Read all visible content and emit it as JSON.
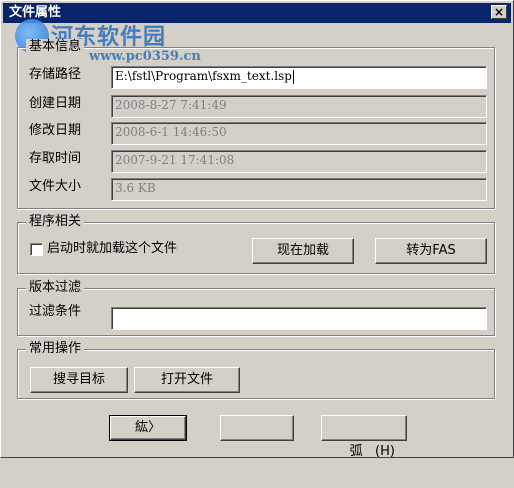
{
  "window": {
    "title": "文件属性",
    "close_label": "×"
  },
  "watermark": {
    "brand": "河东软件园",
    "url": "www.pc0359.cn"
  },
  "basic_info": {
    "group_label": "基本信息",
    "path_label": "存储路径",
    "path_value": "E:\\fstl\\Program\\fsxm_text.lsp",
    "created_label": "创建日期",
    "created_value": "2008-8-27 7:41:49",
    "modified_label": "修改日期",
    "modified_value": "2008-6-1 14:46:50",
    "accessed_label": "存取时间",
    "accessed_value": "2007-9-21 17:41:08",
    "size_label": "文件大小",
    "size_value": "3.6 KB"
  },
  "program": {
    "group_label": "程序相关",
    "autoload_label": "启动时就加载这个文件",
    "autoload_checked": false,
    "load_now_label": "现在加载",
    "convert_label": "转为FAS"
  },
  "version_filter": {
    "group_label": "版本过滤",
    "filter_label": "过滤条件",
    "filter_value": ""
  },
  "common_ops": {
    "group_label": "常用操作",
    "find_target_label": "搜寻目标",
    "open_file_label": "打开文件"
  },
  "footer": {
    "ok_label": "紘〉",
    "middle_label": "",
    "cancel_label": "弧   (H)"
  }
}
